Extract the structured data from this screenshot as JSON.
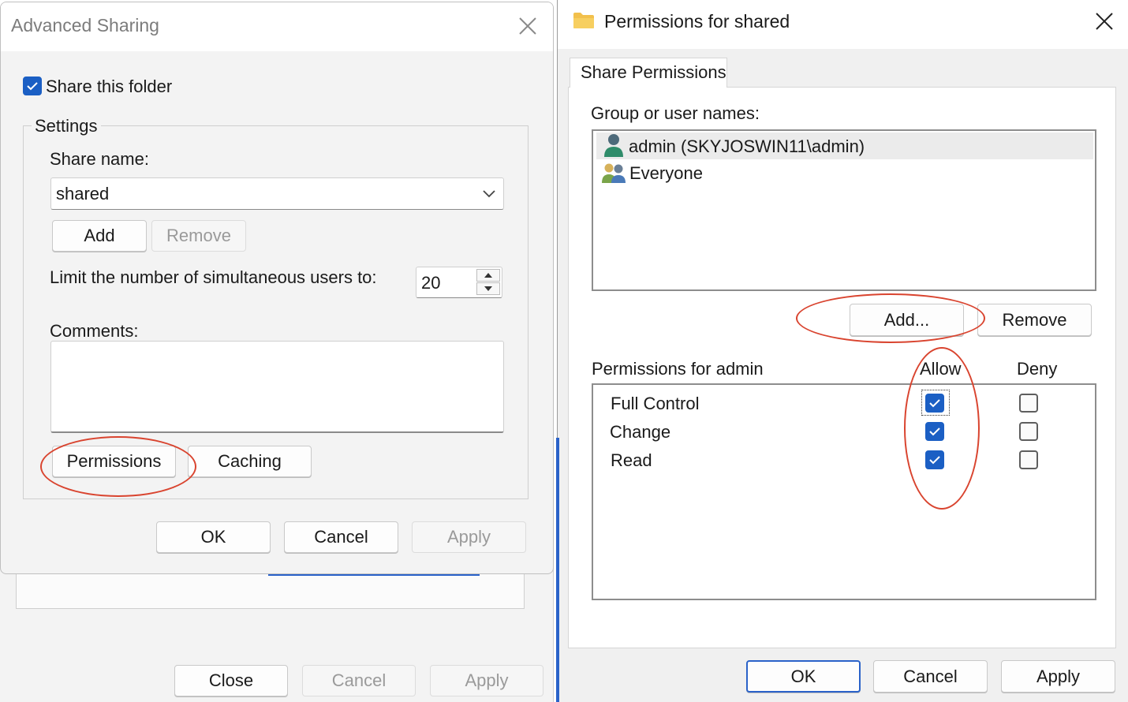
{
  "left_window": {
    "title": "Advanced Sharing",
    "share_checkbox_label": "Share this folder",
    "settings_group": "Settings",
    "share_name_label": "Share name:",
    "share_name_value": "shared",
    "add_label": "Add",
    "remove_label": "Remove",
    "limit_label": "Limit the number of simultaneous users to:",
    "limit_value": "20",
    "comments_label": "Comments:",
    "permissions_label": "Permissions",
    "caching_label": "Caching",
    "ok_label": "OK",
    "cancel_label": "Cancel",
    "apply_label": "Apply"
  },
  "background_window": {
    "close_label": "Close",
    "cancel_label": "Cancel",
    "apply_label": "Apply"
  },
  "right_window": {
    "title": "Permissions for shared",
    "tab_label": "Share Permissions",
    "group_label": "Group or user names:",
    "users": [
      {
        "name": "admin (SKYJOSWIN11\\admin)",
        "icon": "user-icon",
        "selected": true
      },
      {
        "name": "Everyone",
        "icon": "users-group-icon",
        "selected": false
      }
    ],
    "add_label": "Add...",
    "remove_label": "Remove",
    "permissions_for_label": "Permissions for admin",
    "allow_header": "Allow",
    "deny_header": "Deny",
    "permissions": [
      {
        "name": "Full Control",
        "allow": true,
        "deny": false
      },
      {
        "name": "Change",
        "allow": true,
        "deny": false
      },
      {
        "name": "Read",
        "allow": true,
        "deny": false
      }
    ],
    "ok_label": "OK",
    "cancel_label": "Cancel",
    "apply_label": "Apply"
  },
  "colors": {
    "accent": "#1b5fc4",
    "highlight_annotation": "#d9442f"
  }
}
